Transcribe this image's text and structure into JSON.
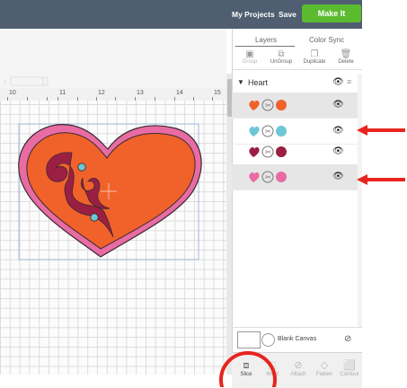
{
  "header": {
    "my_projects": "My Projects",
    "save": "Save",
    "make_it": "Make It",
    "accent_color": "#5bbb2f",
    "bar_color": "#4f5f71"
  },
  "canvas": {
    "ruler_numbers": [
      "10",
      "11",
      "12",
      "13",
      "14",
      "15"
    ],
    "shape": "heart",
    "colors": {
      "outline": "#e86ca3",
      "fill": "#f0622a",
      "swirl": "#9b1e43",
      "dots": "#6ec6d7"
    }
  },
  "panel": {
    "tabs": [
      "Layers",
      "Color Sync"
    ],
    "toolbar": [
      "Group",
      "UnGroup",
      "Duplicate",
      "Delete"
    ],
    "group_name": "Heart",
    "layers": [
      {
        "color": "#f0622a",
        "selected": true
      },
      {
        "color": "#6ec6d7",
        "selected": false
      },
      {
        "color": "#9b1e43",
        "selected": false
      },
      {
        "color": "#e86ca3",
        "selected": true
      }
    ],
    "blank_canvas": "Blank Canvas",
    "actions": [
      "Slice",
      "Weld",
      "Attach",
      "Flatten",
      "Contour"
    ]
  }
}
